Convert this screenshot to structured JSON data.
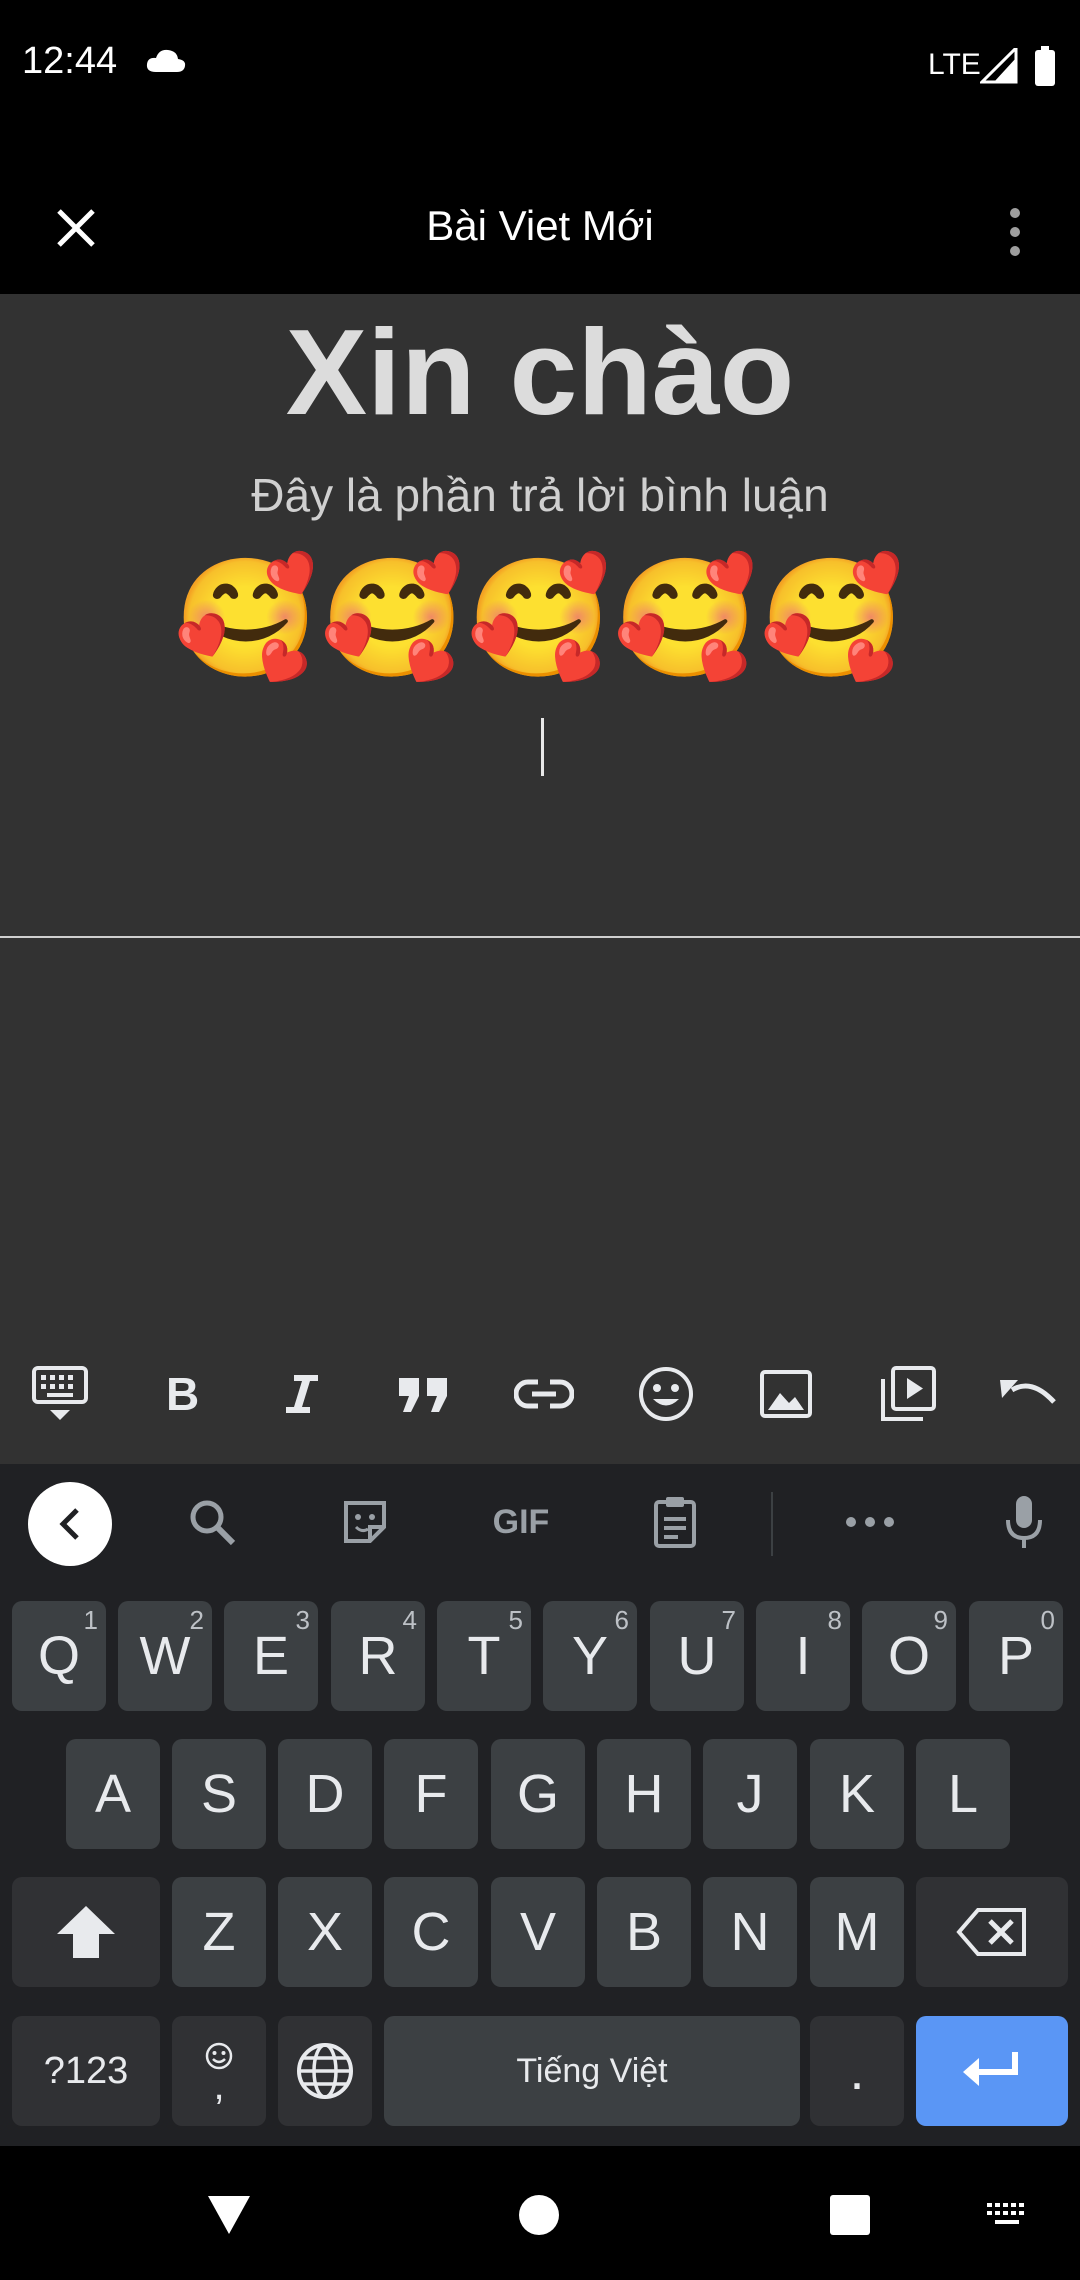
{
  "status_bar": {
    "time": "12:44",
    "network": "LTE",
    "icons": [
      "cloud-icon",
      "signal-icon",
      "battery-icon"
    ]
  },
  "app_bar": {
    "title": "Bài Viet Mới",
    "close_icon": "close-icon",
    "more_icon": "more-vert-icon"
  },
  "editor": {
    "headline": "Xin chào",
    "body": "Đây là phần trả lời bình luận",
    "emojis": "🥰🥰🥰🥰🥰"
  },
  "format_toolbar": {
    "items": [
      "keyboard-hide-icon",
      "bold-icon",
      "italic-icon",
      "quote-icon",
      "link-icon",
      "emoji-icon",
      "image-icon",
      "video-icon",
      "undo-icon"
    ]
  },
  "keyboard": {
    "toolbar": [
      "back-icon",
      "search-icon",
      "sticker-icon",
      "GIF",
      "clipboard-icon",
      "more-icon",
      "mic-icon"
    ],
    "row1": [
      {
        "key": "Q",
        "hint": "1"
      },
      {
        "key": "W",
        "hint": "2"
      },
      {
        "key": "E",
        "hint": "3"
      },
      {
        "key": "R",
        "hint": "4"
      },
      {
        "key": "T",
        "hint": "5"
      },
      {
        "key": "Y",
        "hint": "6"
      },
      {
        "key": "U",
        "hint": "7"
      },
      {
        "key": "I",
        "hint": "8"
      },
      {
        "key": "O",
        "hint": "9"
      },
      {
        "key": "P",
        "hint": "0"
      }
    ],
    "row2": [
      "A",
      "S",
      "D",
      "F",
      "G",
      "H",
      "J",
      "K",
      "L"
    ],
    "row3": [
      "Z",
      "X",
      "C",
      "V",
      "B",
      "N",
      "M"
    ],
    "symbols_label": "?123",
    "comma_label": ",",
    "space_label": "Tiếng Việt",
    "period_label": ".",
    "colors": {
      "background": "#202124",
      "key": "#3c4043",
      "enter": "#5a96f5"
    }
  },
  "nav_bar": {
    "icons": [
      "back-triangle-icon",
      "home-circle-icon",
      "recents-square-icon",
      "keyboard-switch-icon"
    ]
  }
}
